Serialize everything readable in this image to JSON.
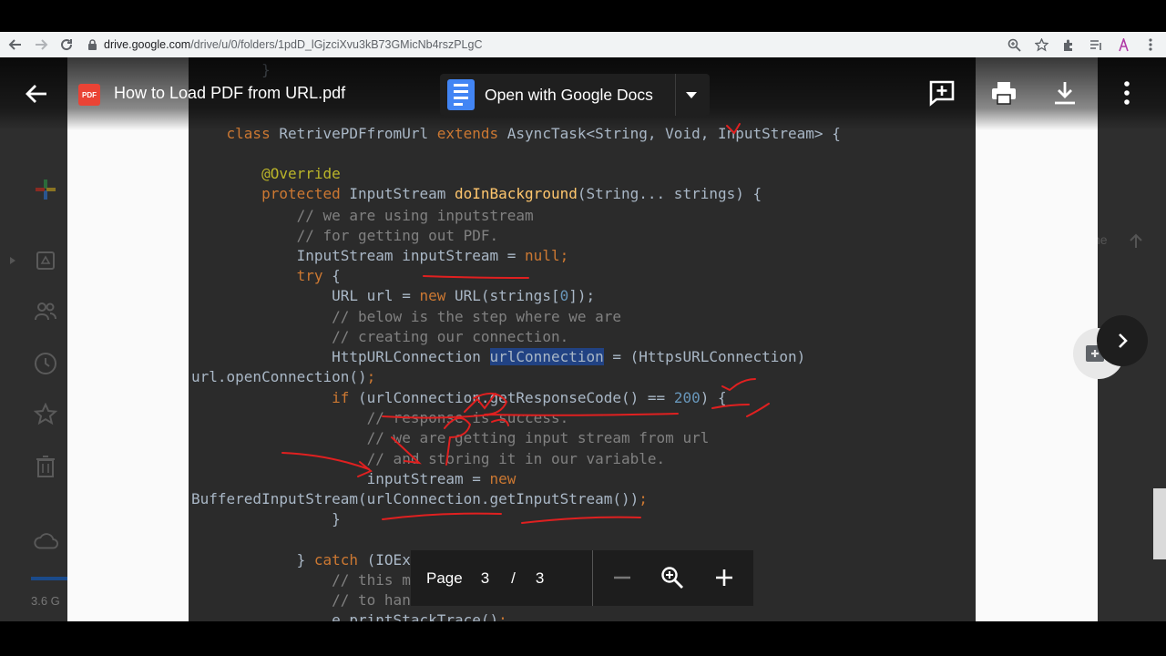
{
  "browser": {
    "url_host": "drive.google.com",
    "url_path": "/drive/u/0/folders/1pdD_lGjzciXvu3kB73GMicNb4rszPLgC"
  },
  "viewer": {
    "file_title": "How to Load PDF from URL.pdf",
    "file_badge": "PDF",
    "open_with_label": "Open with Google Docs"
  },
  "drive": {
    "storage_text": "3.6 G",
    "right_ghost_text": "ne"
  },
  "code": {
    "lines": [
      {
        "parts": [
          {
            "t": "        }",
            "c": "pl"
          }
        ]
      },
      {
        "parts": [
          {
            "t": "    class ",
            "c": "kw"
          },
          {
            "t": "RetrivePDFfromUrl ",
            "c": "pl"
          },
          {
            "t": "extends ",
            "c": "kw"
          },
          {
            "t": "AsyncTask<String, Void, InputStream> {",
            "c": "pl"
          }
        ]
      },
      {
        "parts": [
          {
            "t": "        @Override",
            "c": "an"
          }
        ]
      },
      {
        "parts": [
          {
            "t": "        protected ",
            "c": "kw"
          },
          {
            "t": "InputStream ",
            "c": "pl"
          },
          {
            "t": "doInBackground",
            "c": "fn"
          },
          {
            "t": "(String... strings) {",
            "c": "pl"
          }
        ]
      },
      {
        "parts": [
          {
            "t": "            // we are using inputstream",
            "c": "cm"
          }
        ]
      },
      {
        "parts": [
          {
            "t": "            // for getting out PDF.",
            "c": "cm"
          }
        ]
      },
      {
        "parts": [
          {
            "t": "            InputStream inputStream = ",
            "c": "pl"
          },
          {
            "t": "null",
            "c": "kw"
          },
          {
            "t": ";",
            "c": "kw"
          }
        ]
      },
      {
        "parts": [
          {
            "t": "            try ",
            "c": "kw"
          },
          {
            "t": "{",
            "c": "pl"
          }
        ]
      },
      {
        "parts": [
          {
            "t": "                URL url = ",
            "c": "pl"
          },
          {
            "t": "new ",
            "c": "kw"
          },
          {
            "t": "URL(strings[",
            "c": "pl"
          },
          {
            "t": "0",
            "c": "nm"
          },
          {
            "t": "]);",
            "c": "pl"
          }
        ]
      },
      {
        "parts": [
          {
            "t": "                // below is the step where we are",
            "c": "cm"
          }
        ]
      },
      {
        "parts": [
          {
            "t": "                // creating our connection.",
            "c": "cm"
          }
        ]
      },
      {
        "parts": [
          {
            "t": "                HttpURLConnection ",
            "c": "pl"
          },
          {
            "t": "urlConnection",
            "c": "pl hl2"
          },
          {
            "t": " = (HttpsURLConnection)",
            "c": "pl"
          }
        ]
      },
      {
        "parts": [
          {
            "t": "url.openConnection()",
            "c": "pl"
          },
          {
            "t": ";",
            "c": "kw"
          }
        ]
      },
      {
        "parts": [
          {
            "t": "                if ",
            "c": "kw"
          },
          {
            "t": "(urlConnection.getResponseCode() == ",
            "c": "pl"
          },
          {
            "t": "200",
            "c": "nm"
          },
          {
            "t": ") {",
            "c": "pl"
          }
        ]
      },
      {
        "parts": [
          {
            "t": "                    // response is success.",
            "c": "cm"
          }
        ]
      },
      {
        "parts": [
          {
            "t": "                    // we are getting input stream from url",
            "c": "cm"
          }
        ]
      },
      {
        "parts": [
          {
            "t": "                    // and storing it in our variable.",
            "c": "cm"
          }
        ]
      },
      {
        "parts": [
          {
            "t": "                    inputStream = ",
            "c": "pl"
          },
          {
            "t": "new",
            "c": "kw"
          }
        ]
      },
      {
        "parts": [
          {
            "t": "BufferedInputStream(urlConnection.getInputStream())",
            "c": "pl"
          },
          {
            "t": ";",
            "c": "kw"
          }
        ]
      },
      {
        "parts": [
          {
            "t": "                }",
            "c": "pl"
          }
        ]
      },
      {
        "parts": [
          {
            "t": "",
            "c": "pl"
          }
        ]
      },
      {
        "parts": [
          {
            "t": "            } ",
            "c": "pl"
          },
          {
            "t": "catch ",
            "c": "kw"
          },
          {
            "t": "(IOException e) {",
            "c": "pl"
          }
        ]
      },
      {
        "parts": [
          {
            "t": "                // this method is used",
            "c": "cm"
          }
        ]
      },
      {
        "parts": [
          {
            "t": "                // to handle errors.",
            "c": "cm"
          }
        ]
      },
      {
        "parts": [
          {
            "t": "                e.printStackTrace()",
            "c": "pl"
          },
          {
            "t": ";",
            "c": "kw"
          }
        ]
      }
    ]
  },
  "page_control": {
    "label": "Page",
    "current": "3",
    "separator": "/",
    "total": "3"
  },
  "annotation_text": "PDF"
}
